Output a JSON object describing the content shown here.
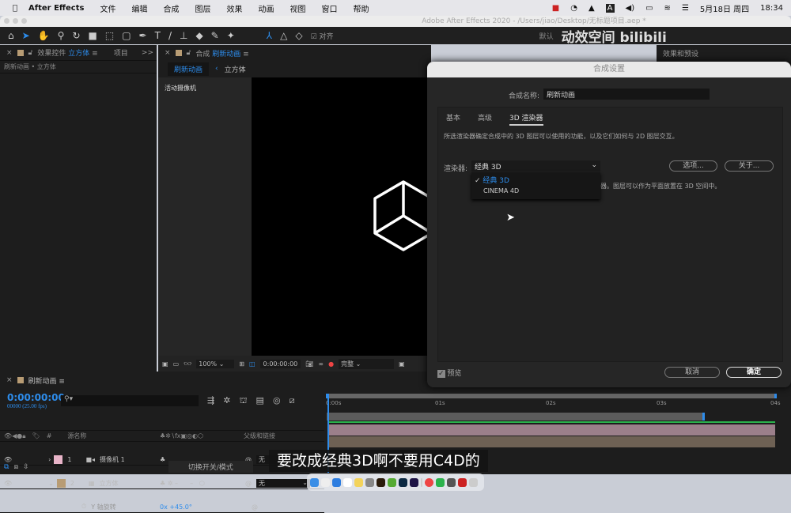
{
  "menubar": {
    "app": "After Effects",
    "items": [
      "文件",
      "编辑",
      "合成",
      "图层",
      "效果",
      "动画",
      "视图",
      "窗口",
      "帮助"
    ],
    "date": "5月18日 周四",
    "time": "18:34",
    "icons": [
      "record-icon",
      "clock-icon",
      "photo-icon",
      "input-a-icon",
      "volume-icon",
      "battery-icon",
      "wifi-icon",
      "control-center-icon"
    ]
  },
  "window": {
    "title": "Adobe After Effects 2020 - /Users/jiao/Desktop/无标题项目.aep *"
  },
  "toolbar": {
    "snap_label": "对齐",
    "workspace": "默认",
    "watermark": "动效空间 bilibili",
    "overflow": ">>",
    "help": "帮助"
  },
  "left_panel": {
    "tab_prefix": "效果控件",
    "tab_layer": "立方体",
    "tab2": "项目",
    "breadcrumb": "刷新动画 • 立方体",
    "more": ">>"
  },
  "comp_panel": {
    "tab_prefix": "合成",
    "tab_name": "刷新动画",
    "crumb1": "刷新动画",
    "crumb2": "立方体",
    "camera_label": "活动摄像机",
    "zoom": "100%",
    "timecode": "0:00:00:00",
    "quality": "完整"
  },
  "right_panel": {
    "title": "效果和预设"
  },
  "dialog": {
    "title": "合成设置",
    "name_label": "合成名称:",
    "name_value": "刷新动画",
    "tabs": [
      "基本",
      "高级",
      "3D 渲染器"
    ],
    "active_tab": 2,
    "description": "所选渲染器确定合成中的 3D 图层可以使用的功能，以及它们如何与 2D 图层交互。",
    "renderer_label": "渲染器:",
    "renderer_value": "经典 3D",
    "options_button": "选项...",
    "about_button": "关于...",
    "renderer_note": "器。图层可以作为平面放置在 3D 空间中。",
    "dropdown_options": [
      "经典 3D",
      "CINEMA 4D"
    ],
    "selected_option": 0,
    "preview_label": "预览",
    "preview_checked": true,
    "cancel": "取消",
    "ok": "确定"
  },
  "timeline": {
    "tab": "刷新动画",
    "timecode": "0:00:00:00",
    "fps": "00000 (25.00 fps)",
    "search_placeholder": "",
    "col_hash": "#",
    "col_name": "源名称",
    "col_parent": "父级和链接",
    "ruler": [
      "0:00s",
      "01s",
      "02s",
      "03s",
      "04s"
    ],
    "layers": [
      {
        "num": "1",
        "name": "摄像机 1",
        "color": "#e8b4c8",
        "parent": "无"
      },
      {
        "num": "2",
        "name": "立方体",
        "color": "#b89c74",
        "parent": "无"
      }
    ],
    "property": {
      "name": "Y 轴旋转",
      "value": "0x +45.0°"
    },
    "toggle_label": "切换开关/模式"
  },
  "subtitle": "要改成经典3D啊不要用C4D的",
  "colors": {
    "accent": "#2d8ceb",
    "track_green": "#2bb24c"
  }
}
